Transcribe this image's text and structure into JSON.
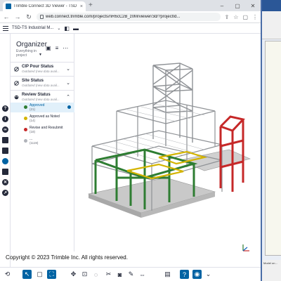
{
  "browser": {
    "tab_title": "Trimble Connect 3D Viewer - TSD",
    "tab_close": "×",
    "new_tab": "+",
    "url": "web.connect.trimble.com/projects/nR6cC2B_z0M/viewer/3d/?projectId...",
    "window_controls": [
      "–",
      "▢",
      "✕"
    ]
  },
  "app": {
    "project_name": "TSD-TS Industrial M...",
    "project_chevron": "⌄"
  },
  "organizer": {
    "title": "Organizer",
    "subtitle_line1": "Everything in",
    "subtitle_line2": "project",
    "groups": [
      {
        "label": "CIP Pour Status",
        "sub": "Outdated (new data avail...",
        "chevron": "⌄"
      },
      {
        "label": "Site Status",
        "sub": "Outdated (new data avail...",
        "chevron": "⌄"
      },
      {
        "label": "Review Status",
        "sub": "Outdated (new data avail...",
        "chevron": "⌃"
      }
    ],
    "items": [
      {
        "label": "Approved",
        "count": "(21)",
        "color": "#2e7d32",
        "selected": true
      },
      {
        "label": "Approved as Noted",
        "count": "(14)",
        "color": "#d4b400",
        "selected": false
      },
      {
        "label": "Revise and Resubmit",
        "count": "(18)",
        "color": "#c62828",
        "selected": false
      },
      {
        "label": "...",
        "count": "(1119)",
        "color": "#b0b3ba",
        "selected": false
      }
    ]
  },
  "viewer": {
    "copyright": "Copyright © 2023 Trimble Inc. All rights reserved.",
    "accent": "#0063a3"
  },
  "right_window": {
    "status": "Model on..."
  }
}
